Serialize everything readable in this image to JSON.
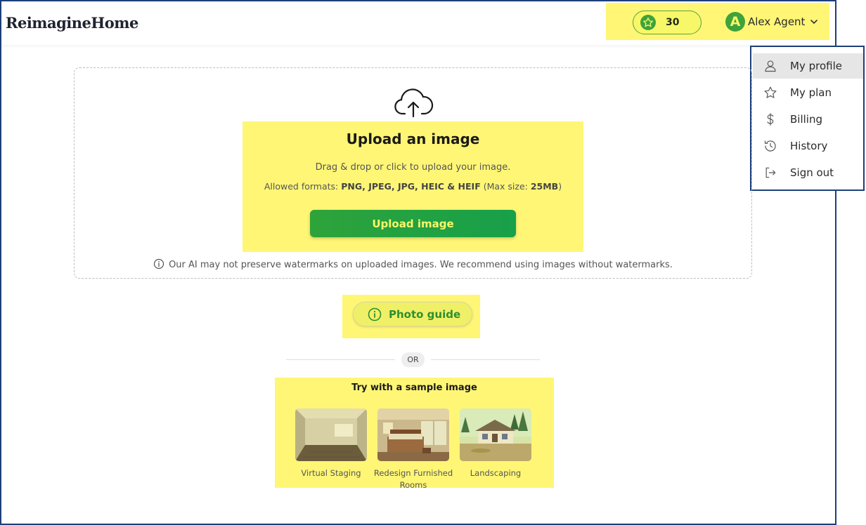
{
  "header": {
    "logo": "ReimagineHome",
    "credits": "30",
    "user_initial": "A",
    "user_name": "Alex Agent"
  },
  "menu": {
    "items": [
      {
        "label": "My profile",
        "icon": "user-icon",
        "active": true
      },
      {
        "label": "My plan",
        "icon": "star-icon"
      },
      {
        "label": "Billing",
        "icon": "dollar-icon"
      },
      {
        "label": "History",
        "icon": "history-icon"
      },
      {
        "label": "Sign out",
        "icon": "sign-out-icon"
      }
    ]
  },
  "upload": {
    "title": "Upload an image",
    "description": "Drag & drop or click to upload your image.",
    "formats_prefix": "Allowed formats: ",
    "formats": "PNG, JPEG, JPG, HEIC & HEIF",
    "maxsize_prefix": " (Max size: ",
    "maxsize": "25MB",
    "maxsize_suffix": ")",
    "button": "Upload image",
    "notice": "Our AI may not preserve watermarks on uploaded images. We recommend using images without watermarks."
  },
  "guide": {
    "button": "Photo guide"
  },
  "divider": {
    "or": "OR"
  },
  "samples": {
    "title": "Try with a sample image",
    "items": [
      {
        "label": "Virtual Staging"
      },
      {
        "label": "Redesign Furnished Rooms"
      },
      {
        "label": "Landscaping"
      }
    ]
  },
  "colors": {
    "highlight": "#fff676",
    "accent_green": "#2ea33a",
    "frame_blue": "#1d3f7a"
  }
}
